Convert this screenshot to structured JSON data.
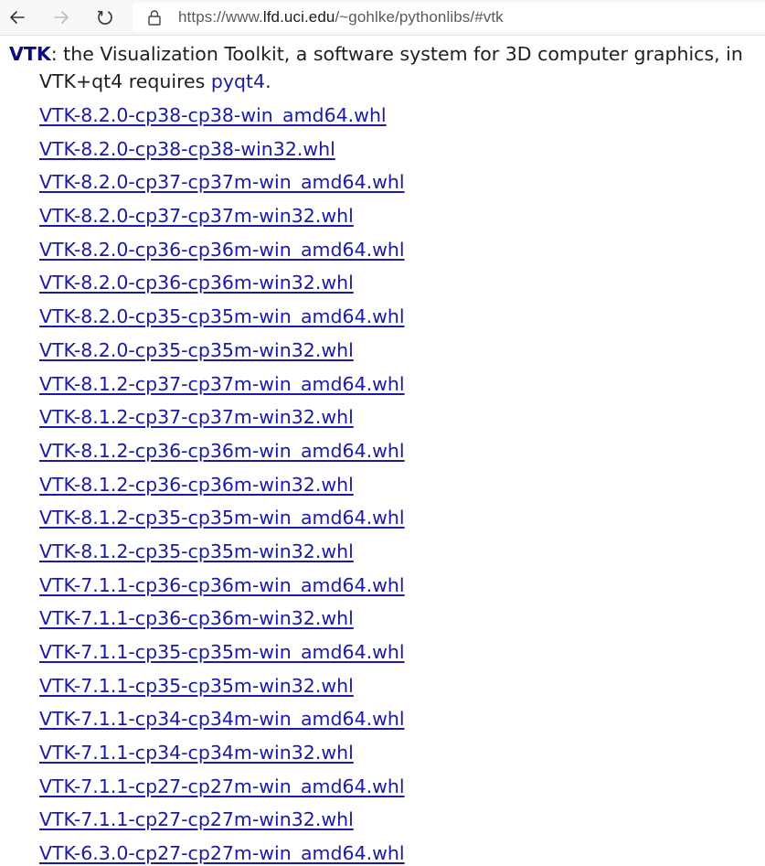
{
  "browser": {
    "url_prefix": "https://www.",
    "url_host": "lfd.uci.edu",
    "url_path": "/~gohlke/pythonlibs/#vtk"
  },
  "page": {
    "package_name": "VTK",
    "package_desc": ": the Visualization Toolkit, a software system for 3D computer graphics, in",
    "qt_prefix": "VTK+qt4 requires ",
    "qt_link": "pyqt4",
    "qt_suffix": ".",
    "files": [
      "VTK-8.2.0-cp38-cp38-win_amd64.whl",
      "VTK-8.2.0-cp38-cp38-win32.whl",
      "VTK-8.2.0-cp37-cp37m-win_amd64.whl",
      "VTK-8.2.0-cp37-cp37m-win32.whl",
      "VTK-8.2.0-cp36-cp36m-win_amd64.whl",
      "VTK-8.2.0-cp36-cp36m-win32.whl",
      "VTK-8.2.0-cp35-cp35m-win_amd64.whl",
      "VTK-8.2.0-cp35-cp35m-win32.whl",
      "VTK-8.1.2-cp37-cp37m-win_amd64.whl",
      "VTK-8.1.2-cp37-cp37m-win32.whl",
      "VTK-8.1.2-cp36-cp36m-win_amd64.whl",
      "VTK-8.1.2-cp36-cp36m-win32.whl",
      "VTK-8.1.2-cp35-cp35m-win_amd64.whl",
      "VTK-8.1.2-cp35-cp35m-win32.whl",
      "VTK-7.1.1-cp36-cp36m-win_amd64.whl",
      "VTK-7.1.1-cp36-cp36m-win32.whl",
      "VTK-7.1.1-cp35-cp35m-win_amd64.whl",
      "VTK-7.1.1-cp35-cp35m-win32.whl",
      "VTK-7.1.1-cp34-cp34m-win_amd64.whl",
      "VTK-7.1.1-cp34-cp34m-win32.whl",
      "VTK-7.1.1-cp27-cp27m-win_amd64.whl",
      "VTK-7.1.1-cp27-cp27m-win32.whl",
      "VTK-6.3.0-cp27-cp27m-win_amd64.whl"
    ]
  },
  "icons": {
    "back": "back-arrow-icon",
    "forward": "forward-arrow-icon",
    "refresh": "refresh-icon",
    "lock": "lock-icon"
  },
  "colors": {
    "link": "#1a1aa6",
    "package_name": "#0d0d80",
    "toolbar_bg": "#f7f7f7"
  }
}
